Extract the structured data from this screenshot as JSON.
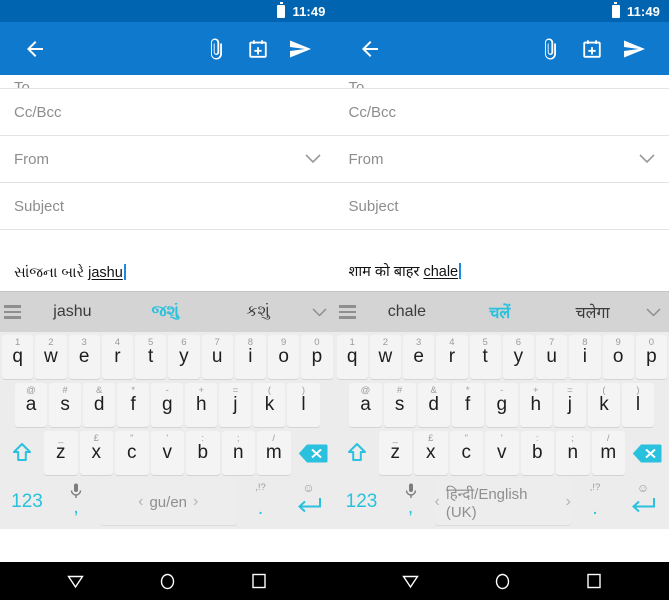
{
  "statusbar": {
    "time": "11:49",
    "battery_icon": "battery-icon"
  },
  "toolbar": {
    "back_icon": "back-arrow-icon",
    "attach_icon": "paperclip-icon",
    "calendar_icon": "calendar-add-icon",
    "send_icon": "send-icon",
    "accent_color": "#0f79ce",
    "status_color": "#0164b0"
  },
  "panels": [
    {
      "id": "left",
      "compose": {
        "to_label": "To",
        "cc_bcc_label": "Cc/Bcc",
        "from_label": "From",
        "subject_label": "Subject",
        "body_prefix": "સાંજના બારે ",
        "body_composing": "jashu"
      },
      "keyboard": {
        "suggestions": [
          {
            "text": "jashu",
            "active": false
          },
          {
            "text": "જશું",
            "active": true
          },
          {
            "text": "કશું",
            "active": false
          }
        ],
        "menu_icon": "hamburger-icon",
        "expand_icon": "chevron-down-icon",
        "space_label": "gu/en",
        "num_label": "123",
        "comma_label": ",",
        "period_label": ".",
        "period_hint": ",!?",
        "mic_icon": "microphone-icon",
        "emoji_icon": "emoji-icon",
        "enter_icon": "return-icon",
        "shift_icon": "shift-icon",
        "delete_icon": "backspace-icon"
      }
    },
    {
      "id": "right",
      "compose": {
        "to_label": "To",
        "cc_bcc_label": "Cc/Bcc",
        "from_label": "From",
        "subject_label": "Subject",
        "body_prefix": "शाम को बाहर ",
        "body_composing": "chale"
      },
      "keyboard": {
        "suggestions": [
          {
            "text": "chale",
            "active": false
          },
          {
            "text": "चलें",
            "active": true
          },
          {
            "text": "चलेगा",
            "active": false
          }
        ],
        "menu_icon": "hamburger-icon",
        "expand_icon": "chevron-down-icon",
        "space_label": "हिन्दी/English (UK)",
        "num_label": "123",
        "comma_label": ",",
        "period_label": ".",
        "period_hint": ",!?",
        "mic_icon": "microphone-icon",
        "emoji_icon": "emoji-icon",
        "enter_icon": "return-icon",
        "shift_icon": "shift-icon",
        "delete_icon": "backspace-icon"
      }
    }
  ],
  "keyboard_layout": {
    "row1": [
      {
        "key": "q",
        "hint": "1"
      },
      {
        "key": "w",
        "hint": "2"
      },
      {
        "key": "e",
        "hint": "3"
      },
      {
        "key": "r",
        "hint": "4"
      },
      {
        "key": "t",
        "hint": "5"
      },
      {
        "key": "y",
        "hint": "6"
      },
      {
        "key": "u",
        "hint": "7"
      },
      {
        "key": "i",
        "hint": "8"
      },
      {
        "key": "o",
        "hint": "9"
      },
      {
        "key": "p",
        "hint": "0"
      }
    ],
    "row2": [
      {
        "key": "a",
        "hint": "@"
      },
      {
        "key": "s",
        "hint": "#"
      },
      {
        "key": "d",
        "hint": "&"
      },
      {
        "key": "f",
        "hint": "*"
      },
      {
        "key": "g",
        "hint": "-"
      },
      {
        "key": "h",
        "hint": "+"
      },
      {
        "key": "j",
        "hint": "="
      },
      {
        "key": "k",
        "hint": "("
      },
      {
        "key": "l",
        "hint": ")"
      }
    ],
    "row3": [
      {
        "key": "z",
        "hint": "_"
      },
      {
        "key": "x",
        "hint": "£"
      },
      {
        "key": "c",
        "hint": "\""
      },
      {
        "key": "v",
        "hint": "'"
      },
      {
        "key": "b",
        "hint": ":"
      },
      {
        "key": "n",
        "hint": ";"
      },
      {
        "key": "m",
        "hint": "/"
      }
    ]
  },
  "navbar": {
    "back_icon": "nav-back-triangle-icon",
    "home_icon": "nav-home-circle-icon",
    "recents_icon": "nav-recents-square-icon"
  },
  "colors": {
    "toolbar_blue": "#0f79ce",
    "status_blue": "#0164b0",
    "suggestion_bg": "#d4d4d4",
    "keyboard_bg": "#ececec",
    "key_bg": "#f4f4f4",
    "accent_cyan": "#29c1dd",
    "nav_bg": "#000000"
  }
}
